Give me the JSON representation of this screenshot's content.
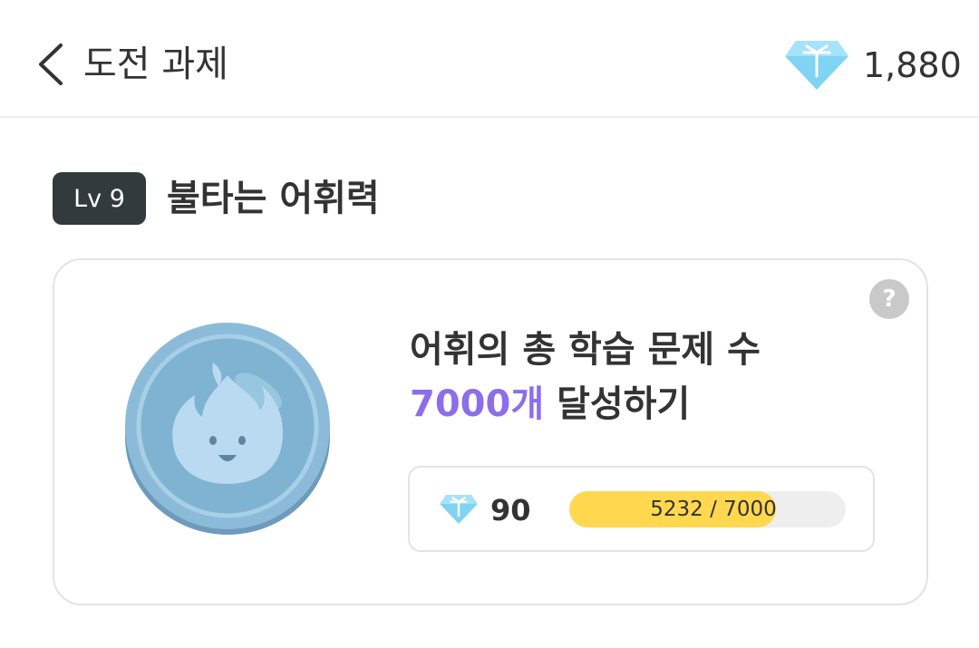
{
  "header": {
    "title": "도전 과제",
    "gem_count": "1,880",
    "back_icon": "chevron-left-icon",
    "gem_icon": "diamond-icon"
  },
  "challenge": {
    "level": "Lv 9",
    "title": "불타는 어휘력",
    "description_line1": "어휘의 총 학습 문제 수",
    "description_accent": "7000개",
    "description_rest": " 달성하기",
    "medal_icon": "fire-medal-icon",
    "help_label": "?",
    "reward": {
      "gem_icon": "diamond-icon",
      "amount": "90"
    },
    "progress": {
      "text": "5232 / 7000",
      "current": 5232,
      "total": 7000
    }
  },
  "colors": {
    "accent_purple": "#8c6dec",
    "progress_yellow": "#ffd84f",
    "badge_dark": "#323a3e",
    "gem_blue": "#7fd3f3"
  }
}
